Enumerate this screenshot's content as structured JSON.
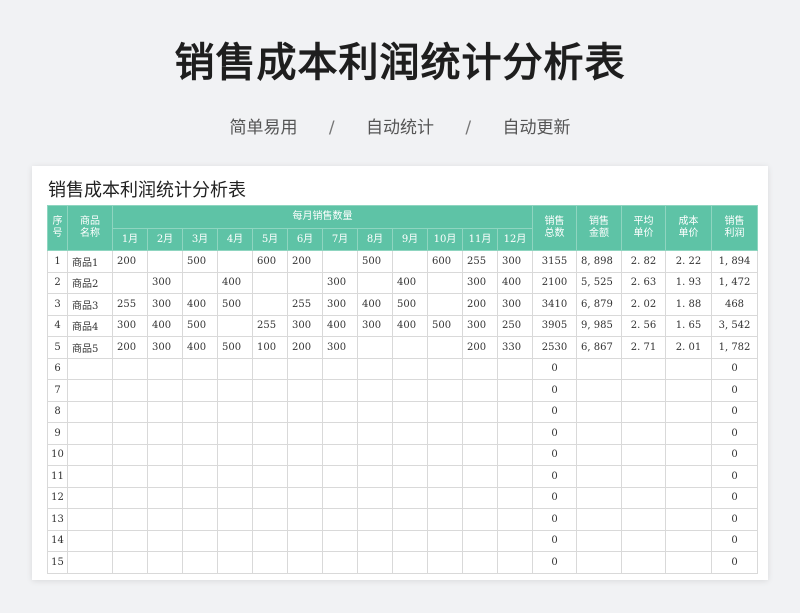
{
  "header": {
    "title": "销售成本利润统计分析表",
    "tags": [
      "简单易用",
      "自动统计",
      "自动更新"
    ],
    "separator": "/"
  },
  "sheet": {
    "title": "销售成本利润统计分析表",
    "columns": {
      "seq": "序\n号",
      "product": "商品\n名称",
      "monthly_group": "每月销售数量",
      "months": [
        "1月",
        "2月",
        "3月",
        "4月",
        "5月",
        "6月",
        "7月",
        "8月",
        "9月",
        "10月",
        "11月",
        "12月"
      ],
      "total_qty": "销售\n总数",
      "amount": "销售\n金额",
      "avg_price": "平均\n单价",
      "cost_price": "成本\n单价",
      "profit": "销售\n利润"
    },
    "rows": [
      {
        "seq": "1",
        "name": "商品1",
        "months": [
          "200",
          "",
          "500",
          "",
          "600",
          "200",
          "",
          "500",
          "",
          "600",
          "255",
          "300"
        ],
        "total": "3155",
        "amount": "8, 898",
        "avg": "2. 82",
        "cost": "2. 22",
        "profit": "1, 894"
      },
      {
        "seq": "2",
        "name": "商品2",
        "months": [
          "",
          "300",
          "",
          "400",
          "",
          "",
          "300",
          "",
          "400",
          "",
          "300",
          "400"
        ],
        "total": "2100",
        "amount": "5, 525",
        "avg": "2. 63",
        "cost": "1. 93",
        "profit": "1, 472"
      },
      {
        "seq": "3",
        "name": "商品3",
        "months": [
          "255",
          "300",
          "400",
          "500",
          "",
          "255",
          "300",
          "400",
          "500",
          "",
          "200",
          "300"
        ],
        "total": "3410",
        "amount": "6, 879",
        "avg": "2. 02",
        "cost": "1. 88",
        "profit": "468"
      },
      {
        "seq": "4",
        "name": "商品4",
        "months": [
          "300",
          "400",
          "500",
          "",
          "255",
          "300",
          "400",
          "300",
          "400",
          "500",
          "300",
          "250"
        ],
        "total": "3905",
        "amount": "9, 985",
        "avg": "2. 56",
        "cost": "1. 65",
        "profit": "3, 542"
      },
      {
        "seq": "5",
        "name": "商品5",
        "months": [
          "200",
          "300",
          "400",
          "500",
          "100",
          "200",
          "300",
          "",
          "",
          "",
          "200",
          "330"
        ],
        "total": "2530",
        "amount": "6, 867",
        "avg": "2. 71",
        "cost": "2. 01",
        "profit": "1, 782"
      },
      {
        "seq": "6",
        "name": "",
        "months": [
          "",
          "",
          "",
          "",
          "",
          "",
          "",
          "",
          "",
          "",
          "",
          ""
        ],
        "total": "0",
        "amount": "",
        "avg": "",
        "cost": "",
        "profit": "0"
      },
      {
        "seq": "7",
        "name": "",
        "months": [
          "",
          "",
          "",
          "",
          "",
          "",
          "",
          "",
          "",
          "",
          "",
          ""
        ],
        "total": "0",
        "amount": "",
        "avg": "",
        "cost": "",
        "profit": "0"
      },
      {
        "seq": "8",
        "name": "",
        "months": [
          "",
          "",
          "",
          "",
          "",
          "",
          "",
          "",
          "",
          "",
          "",
          ""
        ],
        "total": "0",
        "amount": "",
        "avg": "",
        "cost": "",
        "profit": "0"
      },
      {
        "seq": "9",
        "name": "",
        "months": [
          "",
          "",
          "",
          "",
          "",
          "",
          "",
          "",
          "",
          "",
          "",
          ""
        ],
        "total": "0",
        "amount": "",
        "avg": "",
        "cost": "",
        "profit": "0"
      },
      {
        "seq": "10",
        "name": "",
        "months": [
          "",
          "",
          "",
          "",
          "",
          "",
          "",
          "",
          "",
          "",
          "",
          ""
        ],
        "total": "0",
        "amount": "",
        "avg": "",
        "cost": "",
        "profit": "0"
      },
      {
        "seq": "11",
        "name": "",
        "months": [
          "",
          "",
          "",
          "",
          "",
          "",
          "",
          "",
          "",
          "",
          "",
          ""
        ],
        "total": "0",
        "amount": "",
        "avg": "",
        "cost": "",
        "profit": "0"
      },
      {
        "seq": "12",
        "name": "",
        "months": [
          "",
          "",
          "",
          "",
          "",
          "",
          "",
          "",
          "",
          "",
          "",
          ""
        ],
        "total": "0",
        "amount": "",
        "avg": "",
        "cost": "",
        "profit": "0"
      },
      {
        "seq": "13",
        "name": "",
        "months": [
          "",
          "",
          "",
          "",
          "",
          "",
          "",
          "",
          "",
          "",
          "",
          ""
        ],
        "total": "0",
        "amount": "",
        "avg": "",
        "cost": "",
        "profit": "0"
      },
      {
        "seq": "14",
        "name": "",
        "months": [
          "",
          "",
          "",
          "",
          "",
          "",
          "",
          "",
          "",
          "",
          "",
          ""
        ],
        "total": "0",
        "amount": "",
        "avg": "",
        "cost": "",
        "profit": "0"
      },
      {
        "seq": "15",
        "name": "",
        "months": [
          "",
          "",
          "",
          "",
          "",
          "",
          "",
          "",
          "",
          "",
          "",
          ""
        ],
        "total": "0",
        "amount": "",
        "avg": "",
        "cost": "",
        "profit": "0"
      }
    ]
  },
  "colors": {
    "header_bg": "#5ec3a6",
    "page_bg": "#f1f2f4"
  }
}
